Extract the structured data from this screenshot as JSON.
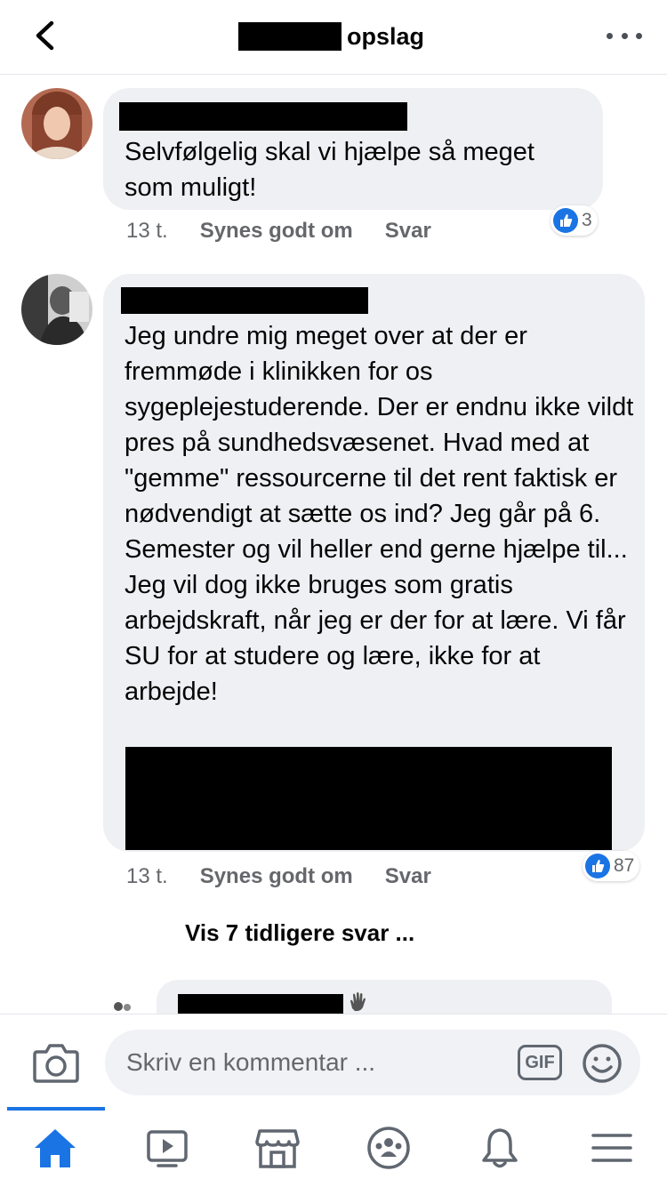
{
  "header": {
    "title_suffix": "opslag",
    "back_icon": "chevron-left-icon",
    "more_icon": "more-horizontal-icon"
  },
  "comments": [
    {
      "text": "Selvfølgelig skal vi hjælpe så meget som muligt!",
      "time": "13 t.",
      "like_label": "Synes godt om",
      "reply_label": "Svar",
      "reaction_count": "3"
    },
    {
      "text": "Jeg undre mig meget over at der er fremmøde i klinikken for os sygeplejestuderende. Der er endnu ikke vildt pres på sundhedsvæsenet. Hvad med at \"gemme\" ressourcerne til det rent faktisk er nødvendigt at sætte os ind? Jeg går på 6. Semester og vil heller end gerne hjælpe til... Jeg vil dog ikke bruges som gratis arbejdskraft, når jeg er der for at lære. Vi får SU for at studere og lære, ikke for at arbejde!",
      "time": "13 t.",
      "like_label": "Synes godt om",
      "reply_label": "Svar",
      "reaction_count": "87"
    }
  ],
  "more_replies": "Vis 7 tidligere svar ...",
  "compose": {
    "placeholder": "Skriv en kommentar ...",
    "gif_label": "GIF"
  },
  "tabs": [
    "home-icon",
    "video-icon",
    "marketplace-icon",
    "groups-icon",
    "notifications-icon",
    "menu-icon"
  ],
  "colors": {
    "accent": "#1b74e4",
    "bubble": "#eff0f3",
    "meta_text": "#65676b"
  }
}
